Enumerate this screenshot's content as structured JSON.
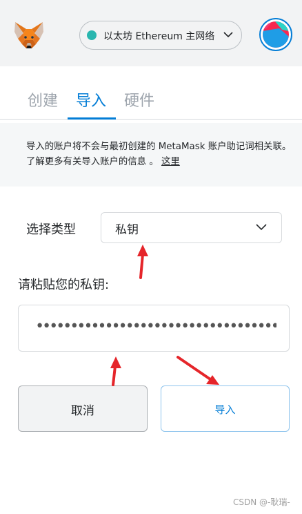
{
  "header": {
    "logo_icon": "metamask-fox-icon",
    "network": {
      "label": "以太坊 Ethereum 主网络",
      "dot_color": "#29b6af",
      "dropdown_icon": "chevron-down-icon"
    },
    "account_avatar_icon": "account-identicon"
  },
  "tabs": [
    {
      "label": "创建",
      "active": false
    },
    {
      "label": "导入",
      "active": true
    },
    {
      "label": "硬件",
      "active": false
    }
  ],
  "notice": {
    "text": "导入的账户将不会与最初创建的 MetaMask 账户助记词相关联。了解更多有关导入账户的信息 。",
    "link": "这里"
  },
  "select_type": {
    "label": "选择类型",
    "value": "私钥"
  },
  "private_key": {
    "label": "请粘贴您的私钥:",
    "masked_value": "••••••••••••••••••••••••••••••••••••••••••••••"
  },
  "buttons": {
    "cancel": "取消",
    "import": "导入"
  },
  "watermark": "CSDN @-耿瑞-",
  "colors": {
    "accent": "#037dd6",
    "annotation_arrow": "#e5252a"
  }
}
